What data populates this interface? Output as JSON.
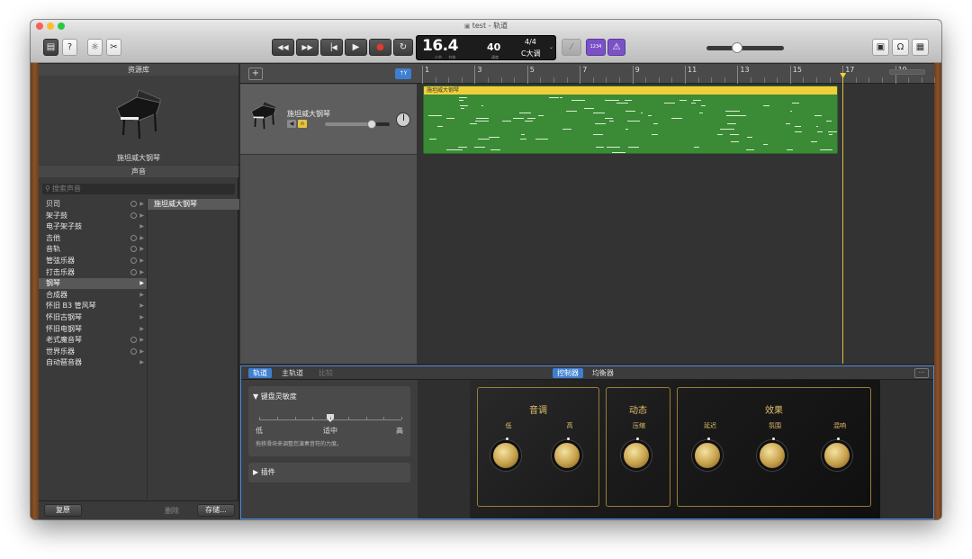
{
  "window": {
    "title": "test - 轨道",
    "lights": [
      "#fc5f57",
      "#fdbc2e",
      "#2ac840"
    ]
  },
  "toolbar": {
    "buttons": [
      {
        "icon": "library-icon",
        "glyph": "▤"
      },
      {
        "icon": "help-icon",
        "glyph": "?"
      },
      {
        "icon": "smart-controls-icon",
        "glyph": "☼"
      },
      {
        "icon": "scissors-icon",
        "glyph": "✂"
      }
    ],
    "transport": [
      {
        "icon": "rewind-icon",
        "glyph": "◀◀"
      },
      {
        "icon": "fast-forward-icon",
        "glyph": "▶▶"
      },
      {
        "icon": "go-to-start-icon",
        "glyph": "▕◀"
      },
      {
        "icon": "play-icon",
        "glyph": "▶"
      },
      {
        "icon": "record-icon",
        "glyph": "●"
      },
      {
        "icon": "cycle-icon",
        "glyph": "↻"
      }
    ],
    "lcd": {
      "position": "16.4",
      "position_labels": [
        "小节",
        "节拍"
      ],
      "tempo": "40",
      "tempo_label": "速度",
      "signature": "4/4",
      "key": "C大调"
    },
    "tuner_icon": "tuner-icon",
    "count_in_label": "1234",
    "metronome_icon": "metronome-icon",
    "master_volume": 0.4,
    "right_buttons": [
      {
        "icon": "notepad-icon",
        "glyph": "▣"
      },
      {
        "icon": "loop-browser-icon",
        "glyph": "Ω"
      },
      {
        "icon": "media-browser-icon",
        "glyph": "▦"
      }
    ]
  },
  "library": {
    "header": "资源库",
    "patch_name": "施坦威大钢琴",
    "sounds_header": "声音",
    "search_placeholder": "搜索声音",
    "categories": [
      {
        "label": "贝司",
        "circle": true
      },
      {
        "label": "架子鼓",
        "circle": true
      },
      {
        "label": "电子架子鼓",
        "circle": false
      },
      {
        "label": "吉他",
        "circle": true
      },
      {
        "label": "音轨",
        "circle": true
      },
      {
        "label": "管弦乐器",
        "circle": true
      },
      {
        "label": "打击乐器",
        "circle": true
      },
      {
        "label": "钢琴",
        "circle": false,
        "selected": true
      },
      {
        "label": "合成器",
        "circle": false
      },
      {
        "label": "怀旧 B3 管风琴",
        "circle": false
      },
      {
        "label": "怀旧古钢琴",
        "circle": false
      },
      {
        "label": "怀旧电钢琴",
        "circle": false
      },
      {
        "label": "老式魔音琴",
        "circle": true
      },
      {
        "label": "世界乐器",
        "circle": true
      },
      {
        "label": "自动琶音器",
        "circle": false
      }
    ],
    "patches": [
      "施坦威大钢琴"
    ],
    "footer": {
      "revert": "复原",
      "delete": "删除",
      "save": "存储..."
    }
  },
  "tracks": {
    "add_button": "+",
    "filter_label": "↑Y",
    "track_name": "施坦威大钢琴",
    "volume": 0.72
  },
  "arrange": {
    "ruler": [
      "1",
      "3",
      "5",
      "7",
      "9",
      "11",
      "13",
      "15",
      "17",
      "19"
    ],
    "region_name": "施坦威大钢琴",
    "playhead_bar": 17
  },
  "smart_controls": {
    "tabs_left": [
      {
        "label": "轨道",
        "on": true
      },
      {
        "label": "主轨道",
        "on": false
      },
      {
        "label": "比较",
        "on": false,
        "dim": true
      }
    ],
    "tabs_center": [
      {
        "label": "控制器",
        "on": true
      },
      {
        "label": "均衡器",
        "on": false
      }
    ],
    "inspector": {
      "section1": "▼ 键盘灵敏度",
      "slider_labels": [
        "低",
        "适中",
        "高"
      ],
      "slider_value": 0.5,
      "hint": "拖移滑块来调整您演奏音符的力度。",
      "section2": "▶ 插件"
    },
    "groups": [
      {
        "title": "音调",
        "knobs": [
          "低",
          "高"
        ]
      },
      {
        "title": "动态",
        "knobs": [
          "压缩"
        ]
      },
      {
        "title": "效果",
        "knobs": [
          "延迟",
          "氛围",
          "混响"
        ]
      }
    ]
  }
}
